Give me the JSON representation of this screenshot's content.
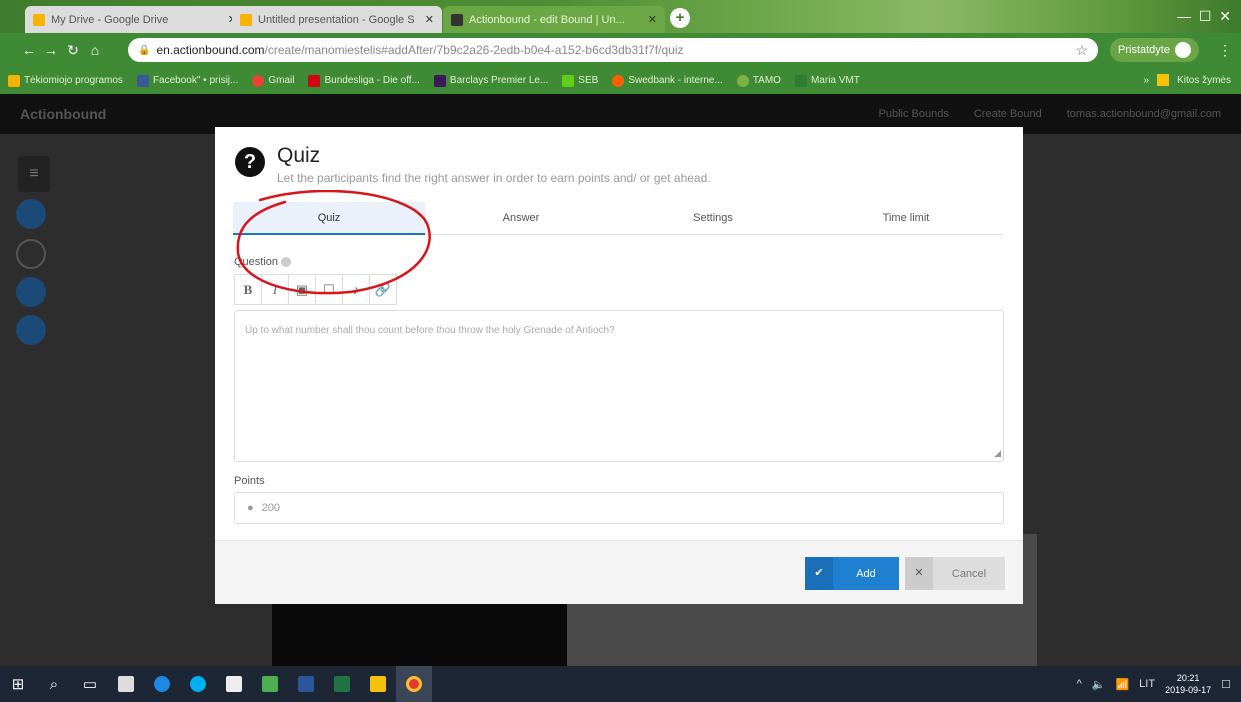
{
  "browser": {
    "tabs": [
      {
        "label": "My Drive - Google Drive",
        "favicon_color": "#f4b400"
      },
      {
        "label": "Untitled presentation - Google S",
        "favicon_color": "#f4b400"
      },
      {
        "label": "Actionbound - edit Bound | Un...",
        "favicon_color": "#333333"
      }
    ],
    "new_tab": "+",
    "address": {
      "host": "en.actionbound.com",
      "path": "/create/manomiestelis#addAfter/7b9c2a26-2edb-b0e4-a152-b6cd3db31f7f/quiz"
    },
    "profile_label": "Pristatdyte",
    "bookmarks": [
      {
        "label": "Tėkiomiojo programos",
        "color": "#f4b400"
      },
      {
        "label": "Facebook\" • prisij...",
        "color": "#3b5998"
      },
      {
        "label": "Gmail",
        "color": "#ea4335"
      },
      {
        "label": "Bundesliga - Die off...",
        "color": "#d20515"
      },
      {
        "label": "Barclays Premier Le...",
        "color": "#3d195b"
      },
      {
        "label": "SEB",
        "color": "#60cd18"
      },
      {
        "label": "Swedbank - interne...",
        "color": "#ff5f00"
      },
      {
        "label": "TAMO",
        "color": "#7cb342"
      },
      {
        "label": "Maria VMT",
        "color": "#2e7d32"
      }
    ],
    "bookmarks_right": "Kitos žymės"
  },
  "app": {
    "logo": "Actionbound",
    "nav": [
      "Public Bounds",
      "Create Bound",
      "tomas.actionbound@gmail.com"
    ]
  },
  "modal": {
    "title": "Quiz",
    "subtitle": "Let the participants find the right answer in order to earn points and/ or get ahead.",
    "tabs": [
      "Quiz",
      "Answer",
      "Settings",
      "Time limit"
    ],
    "question_label": "Question",
    "toolbar": [
      "B",
      "I",
      "▣",
      "☐",
      "♪",
      "🔗"
    ],
    "question_placeholder": "Up to what number shall thou count before thou throw the holy Grenade of Antioch?",
    "points_label": "Points",
    "points_value": "200",
    "add_label": "Add",
    "cancel_label": "Cancel"
  },
  "taskbar": {
    "lang": "LIT",
    "time": "20:21",
    "date": "2019-09-17"
  },
  "colors": {
    "accent": "#1f7fd1",
    "annotation": "#d9151b"
  }
}
